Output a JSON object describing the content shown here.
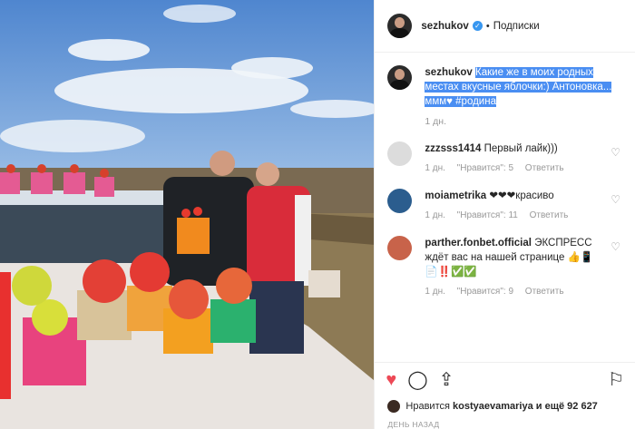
{
  "header": {
    "username": "sezhukov",
    "follow_label": "Подписки"
  },
  "caption": {
    "username": "sezhukov",
    "text": "Какие же в моих родных местах вкусные яблочки:) Антоновка... ммм♥ #родина",
    "time": "1 дн."
  },
  "comments": [
    {
      "username": "zzzsss1414",
      "text": "Первый лайк)))",
      "time": "1 дн.",
      "likes": "\"Нравится\": 5",
      "reply": "Ответить",
      "avatar_color": "#dcdcdc"
    },
    {
      "username": "moiametrika",
      "text": "❤❤❤красиво",
      "time": "1 дн.",
      "likes": "\"Нравится\": 11",
      "reply": "Ответить",
      "avatar_color": "#2b5d8e"
    },
    {
      "username": "parther.fonbet.official",
      "text": "ЭКСПРЕСС ждёт вас на нашей странице 👍📱📄‼️✅✅",
      "time": "1 дн.",
      "likes": "\"Нравится\": 9",
      "reply": "Ответить",
      "avatar_color": "#c8634a"
    }
  ],
  "likes": {
    "prefix": "Нравится",
    "user": "kostyaevamariya",
    "suffix": "и ещё 92 627"
  },
  "posted_ago": "ДЕНЬ НАЗАД",
  "colors": {
    "accent": "#3897f0",
    "like": "#ed4956",
    "highlight": "#4a8ef2"
  }
}
